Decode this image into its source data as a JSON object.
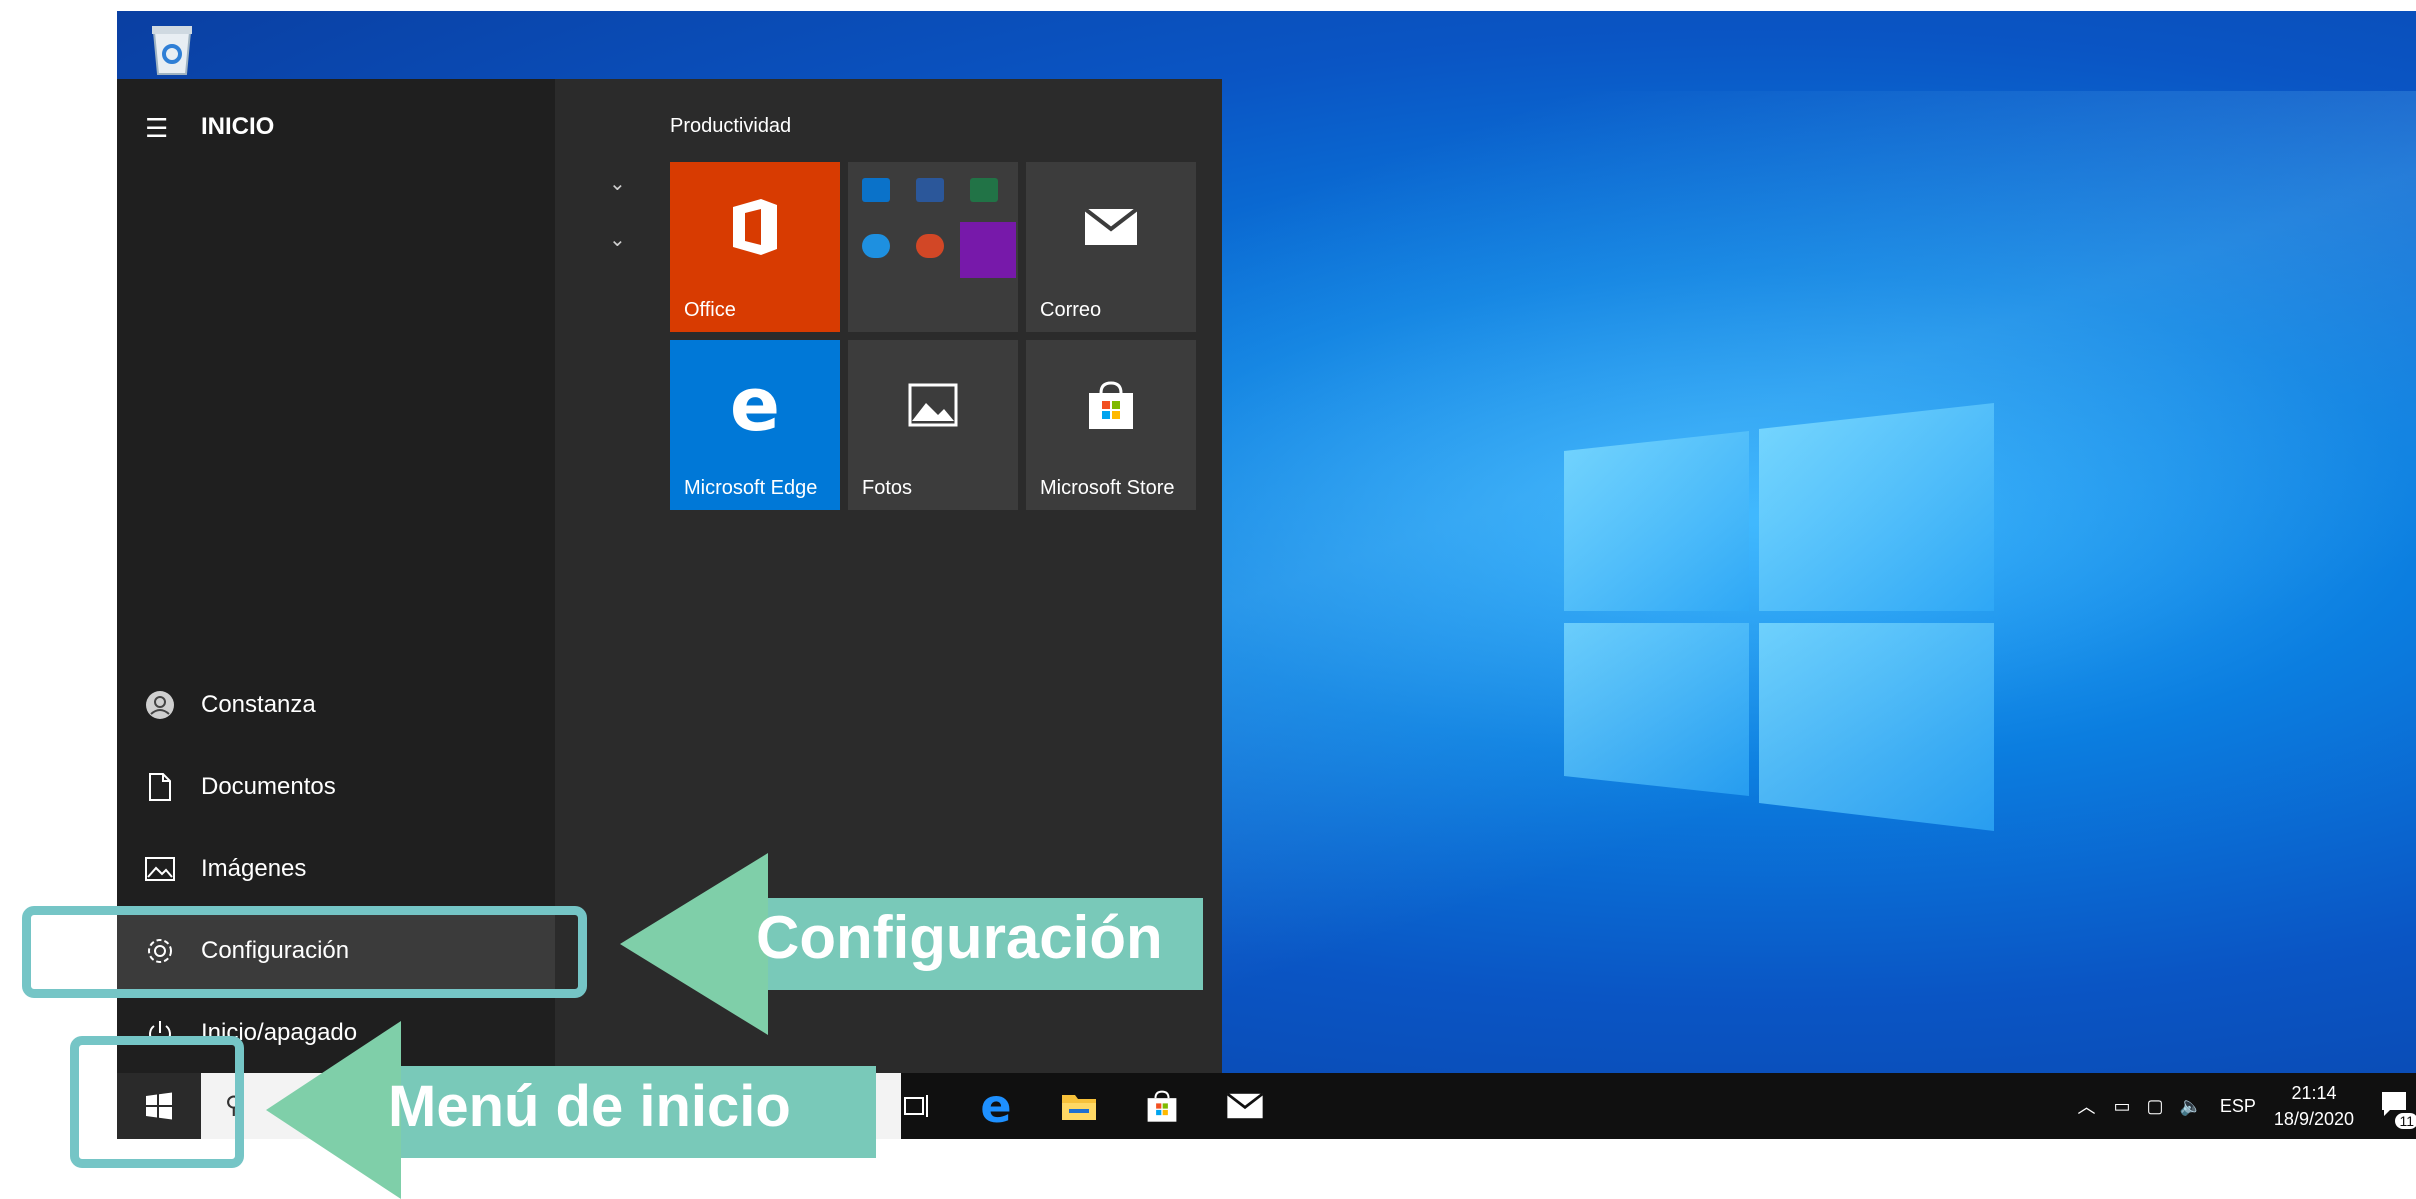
{
  "start_menu": {
    "title": "INICIO",
    "rail_items": [
      {
        "label": "Constanza",
        "icon": "user-icon"
      },
      {
        "label": "Documentos",
        "icon": "document-icon"
      },
      {
        "label": "Imágenes",
        "icon": "pictures-icon"
      },
      {
        "label": "Configuración",
        "icon": "gear-icon"
      },
      {
        "label": "Inicio/apagado",
        "icon": "power-icon"
      }
    ],
    "group_title": "Productividad",
    "tiles": [
      {
        "label": "Office",
        "color": "#d83b01"
      },
      {
        "label": "",
        "color": "#3c3c3c"
      },
      {
        "label": "Correo",
        "color": "#3c3c3c"
      },
      {
        "label": "Microsoft Edge",
        "color": "#0078d7"
      },
      {
        "label": "Fotos",
        "color": "#3c3c3c"
      },
      {
        "label": "Microsoft Store",
        "color": "#3c3c3c"
      }
    ]
  },
  "taskbar": {
    "tray_lang": "ESP",
    "time": "21:14",
    "date": "18/9/2020",
    "notifications": "11"
  },
  "annotations": {
    "settings_callout": "Configuración",
    "start_callout": "Menú de inicio",
    "accent_color": "#75c5c6",
    "arrow_color": "#7fcfa9"
  }
}
